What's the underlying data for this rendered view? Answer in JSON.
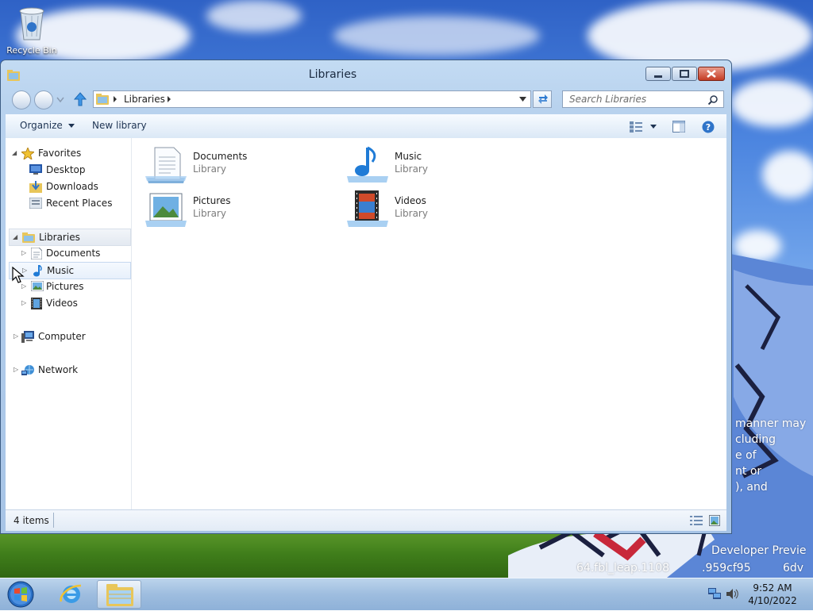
{
  "desktop": {
    "recycle_bin_label": "Recycle Bin",
    "watermark_lines": [
      "manner may",
      "cluding",
      "e of",
      "nt or",
      "), and"
    ],
    "build_lines": [
      "Developer Previe",
      "64.fbl_leap.1108",
      ".959cf95",
      "6dv"
    ]
  },
  "window": {
    "title": "Libraries",
    "address": {
      "path": [
        "Libraries"
      ]
    },
    "search_placeholder": "Search Libraries",
    "commands": {
      "organize": "Organize",
      "new_library": "New library"
    },
    "nav_tree": {
      "favorites": "Favorites",
      "favorites_items": [
        "Desktop",
        "Downloads",
        "Recent Places"
      ],
      "libraries": "Libraries",
      "libraries_items": [
        "Documents",
        "Music",
        "Pictures",
        "Videos"
      ],
      "computer": "Computer",
      "network": "Network"
    },
    "libraries": [
      {
        "name": "Documents",
        "type": "Library",
        "icon": "documents-library-icon"
      },
      {
        "name": "Music",
        "type": "Library",
        "icon": "music-library-icon"
      },
      {
        "name": "Pictures",
        "type": "Library",
        "icon": "pictures-library-icon"
      },
      {
        "name": "Videos",
        "type": "Library",
        "icon": "videos-library-icon"
      }
    ],
    "status": {
      "item_count": "4 items"
    }
  },
  "taskbar": {
    "time": "9:52 AM",
    "date": "4/10/2022"
  },
  "colors": {
    "accent": "#3d5d84",
    "close_button": "#c43c24",
    "taskbar": "#9ebddf"
  }
}
